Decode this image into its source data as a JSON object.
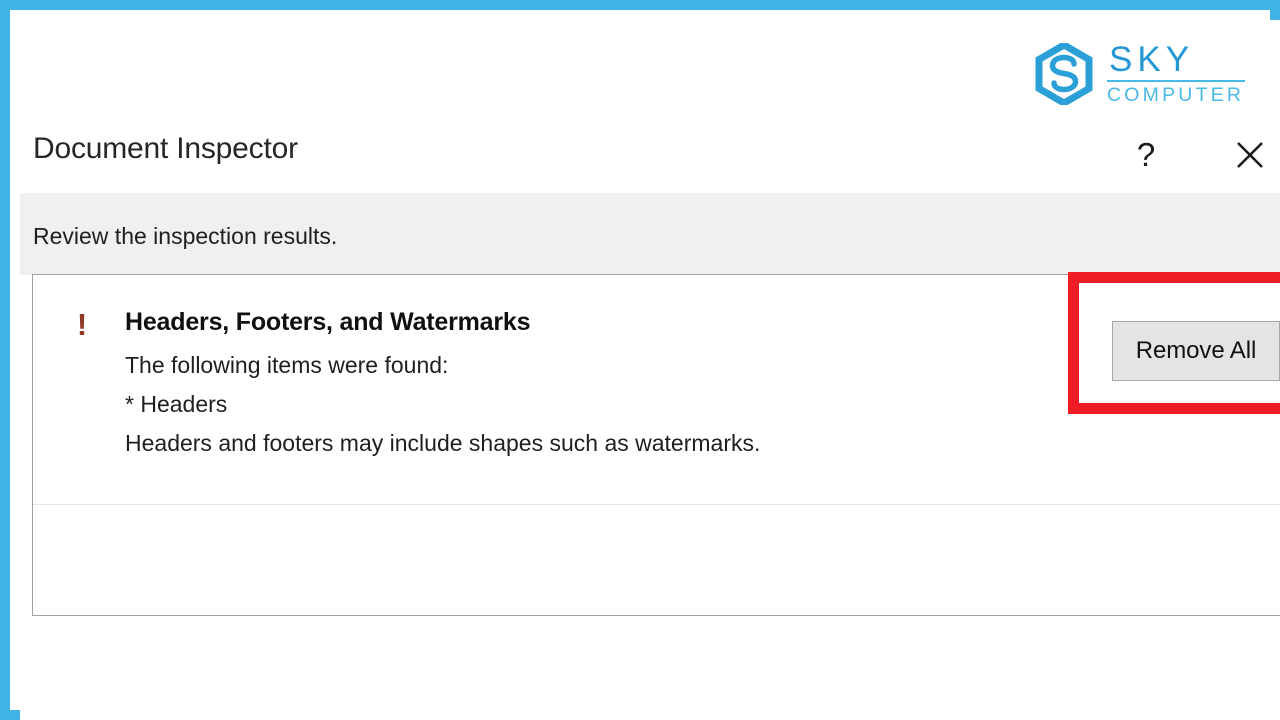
{
  "frame": {
    "border_color": "#3fb3e8"
  },
  "logo": {
    "mark_name": "sky-computer-hexagon-logo",
    "primary_text": "SKY",
    "secondary_text": "COMPUTER",
    "primary_color": "#2497d4",
    "secondary_color": "#4ab9e8"
  },
  "dialog": {
    "title": "Document Inspector",
    "help_label": "?",
    "close_label": "✕",
    "instruction": "Review the inspection results."
  },
  "results": [
    {
      "status_icon": "!",
      "status_color": "#8f3a27",
      "title": "Headers, Footers, and Watermarks",
      "lines": [
        "The following items were found:",
        "* Headers",
        "Headers and footers may include shapes such as watermarks."
      ],
      "action_label": "Remove All"
    }
  ],
  "annotation": {
    "color": "#ee1c25",
    "target": "remove-all-button"
  }
}
